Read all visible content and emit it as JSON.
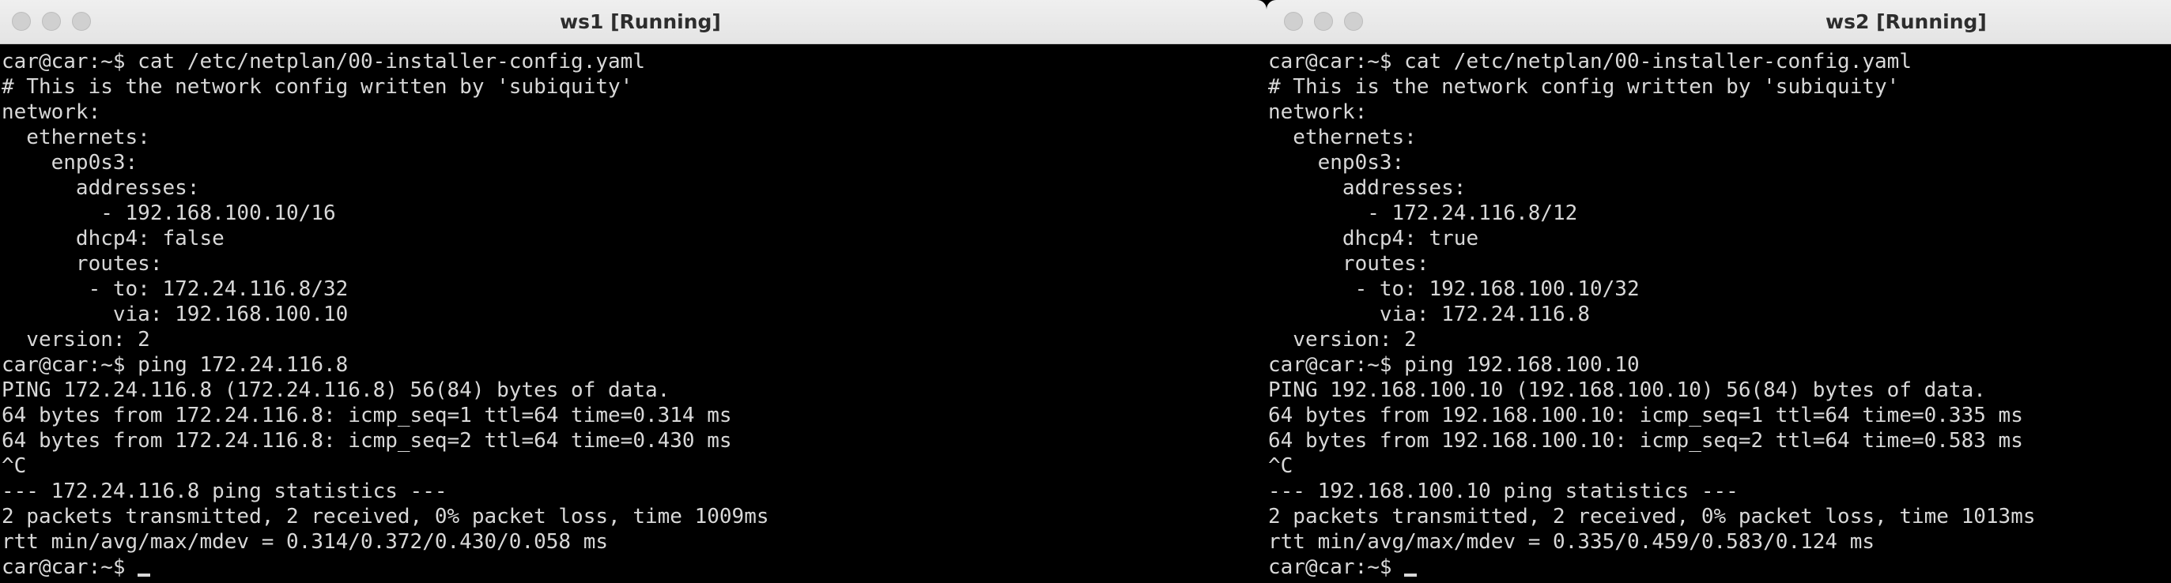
{
  "windows": [
    {
      "title": "ws1 [Running]",
      "lines": [
        "car@car:~$ cat /etc/netplan/00-installer-config.yaml",
        "# This is the network config written by 'subiquity'",
        "network:",
        "  ethernets:",
        "    enp0s3:",
        "      addresses:",
        "        - 192.168.100.10/16",
        "      dhcp4: false",
        "      routes:",
        "       - to: 172.24.116.8/32",
        "         via: 192.168.100.10",
        "  version: 2",
        "car@car:~$ ping 172.24.116.8",
        "PING 172.24.116.8 (172.24.116.8) 56(84) bytes of data.",
        "64 bytes from 172.24.116.8: icmp_seq=1 ttl=64 time=0.314 ms",
        "64 bytes from 172.24.116.8: icmp_seq=2 ttl=64 time=0.430 ms",
        "^C",
        "--- 172.24.116.8 ping statistics ---",
        "2 packets transmitted, 2 received, 0% packet loss, time 1009ms",
        "rtt min/avg/max/mdev = 0.314/0.372/0.430/0.058 ms"
      ],
      "prompt": "car@car:~$ "
    },
    {
      "title": "ws2 [Running]",
      "lines": [
        "car@car:~$ cat /etc/netplan/00-installer-config.yaml",
        "# This is the network config written by 'subiquity'",
        "network:",
        "  ethernets:",
        "    enp0s3:",
        "      addresses:",
        "        - 172.24.116.8/12",
        "      dhcp4: true",
        "      routes:",
        "       - to: 192.168.100.10/32",
        "         via: 172.24.116.8",
        "  version: 2",
        "car@car:~$ ping 192.168.100.10",
        "PING 192.168.100.10 (192.168.100.10) 56(84) bytes of data.",
        "64 bytes from 192.168.100.10: icmp_seq=1 ttl=64 time=0.335 ms",
        "64 bytes from 192.168.100.10: icmp_seq=2 ttl=64 time=0.583 ms",
        "^C",
        "--- 192.168.100.10 ping statistics ---",
        "2 packets transmitted, 2 received, 0% packet loss, time 1013ms",
        "rtt min/avg/max/mdev = 0.335/0.459/0.583/0.124 ms"
      ],
      "prompt": "car@car:~$ "
    }
  ]
}
